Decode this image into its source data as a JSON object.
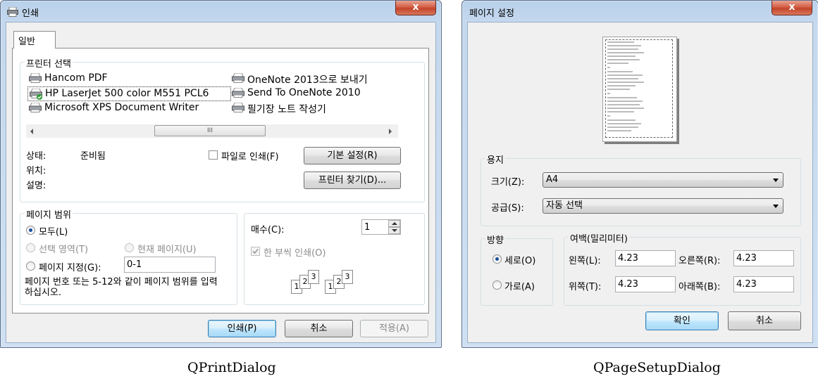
{
  "print_dialog": {
    "title": "인쇄",
    "close": "x",
    "tab": "일반",
    "printer_group_title": "프린터 선택",
    "printers_left": [
      "Hancom PDF",
      "HP LaserJet 500 color M551 PCL6",
      "Microsoft XPS Document Writer"
    ],
    "printers_right": [
      "OneNote 2013으로 보내기",
      "Send To OneNote 2010",
      "필기장 노트 작성기"
    ],
    "scroll_grip": "III",
    "status_label": "상태:",
    "status_value": "준비됨",
    "location_label": "위치:",
    "comment_label": "설명:",
    "print_to_file": "파일로 인쇄(F)",
    "preferences_button": "기본 설정(R)",
    "find_printer_button": "프린터 찾기(D)...",
    "page_range_title": "페이지 범위",
    "range_all": "모두(L)",
    "range_selection": "선택 영역(T)",
    "range_current": "현재 페이지(U)",
    "range_pages": "페이지 지정(G):",
    "range_pages_value": "0-1",
    "range_hint": "페이지 번호 또는 5-12와 같이 페이지 범위를 입력하십시오.",
    "copies_label": "매수(C):",
    "copies_value": "1",
    "collate_label": "한 부씩 인쇄(O)",
    "collate_digits": [
      "1",
      "2",
      "3",
      "1",
      "2",
      "3"
    ],
    "print_button": "인쇄(P)",
    "cancel_button": "취소",
    "apply_button": "적용(A)",
    "caption": "QPrintDialog"
  },
  "page_setup_dialog": {
    "title": "페이지 설정",
    "close": "x",
    "paper_group_title": "용지",
    "size_label": "크기(Z):",
    "size_value": "A4",
    "source_label": "공급(S):",
    "source_value": "자동 선택",
    "orientation_title": "방향",
    "portrait": "세로(O)",
    "landscape": "가로(A)",
    "margins_title": "여백(밀리미터)",
    "left_label": "왼쪽(L):",
    "left_value": "4.23",
    "right_label": "오른쪽(R):",
    "right_value": "4.23",
    "top_label": "위쪽(T):",
    "top_value": "4.23",
    "bottom_label": "아래쪽(B):",
    "bottom_value": "4.23",
    "ok_button": "확인",
    "cancel_button": "취소",
    "caption": "QPageSetupDialog"
  }
}
